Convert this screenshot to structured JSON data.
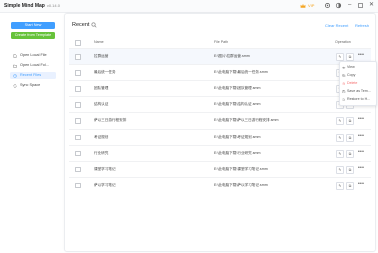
{
  "app": {
    "title": "Simple Mind Map",
    "version": "v0.14.0",
    "vip_label": "VIP"
  },
  "sidebar": {
    "start_label": "Start New",
    "template_label": "Create from Template",
    "items": [
      {
        "label": "Open Local File",
        "icon": "file-icon"
      },
      {
        "label": "Open Local Fol...",
        "icon": "folder-icon"
      },
      {
        "label": "Recent Files",
        "icon": "clock-icon",
        "active": true
      },
      {
        "label": "Sync Space",
        "icon": "sync-icon"
      }
    ]
  },
  "main": {
    "title": "Recent",
    "clear_label": "Clear Recent",
    "refresh_label": "Refresh",
    "columns": {
      "name": "Name",
      "path": "File Path",
      "operation": "Operation"
    },
    "rows": [
      {
        "name": "拉群运营",
        "path": "E:\\图片\\拉群运营.smm"
      },
      {
        "name": "最后统一任务",
        "path": "E:\\此电脑下载\\最后统一任务.smm"
      },
      {
        "name": "团队管理",
        "path": "E:\\此电脑下载\\团队管理.smm"
      },
      {
        "name": "结构认证",
        "path": "E:\\此电脑下载\\结构认证.smm"
      },
      {
        "name": "萨以三日游行程安排",
        "path": "E:\\此电脑下载\\萨以三日游行程安排.smm"
      },
      {
        "name": "考证规划",
        "path": "E:\\此电脑下载\\考证规划.smm"
      },
      {
        "name": "行业研究",
        "path": "E:\\此电脑下载\\行业研究.smm"
      },
      {
        "name": "课堂学习笔记",
        "path": "E:\\此电脑下载\\课堂学习笔记.smm"
      },
      {
        "name": "萨以学习笔记",
        "path": "E:\\此电脑下载\\萨以学习笔记.smm"
      }
    ],
    "op_edit_glyph": "✎",
    "op_open_glyph": "⧉",
    "more_glyph": "•••"
  },
  "dropdown": {
    "items": [
      {
        "label": "View",
        "icon": "eye-icon"
      },
      {
        "label": "Copy",
        "icon": "copy-icon"
      },
      {
        "label": "Delete",
        "icon": "trash-icon",
        "danger": true
      },
      {
        "label": "Save as Tem...",
        "icon": "save-icon"
      },
      {
        "label": "Restore to H...",
        "icon": "restore-icon"
      }
    ]
  },
  "colors": {
    "accent": "#409eff",
    "success": "#67c23a",
    "danger": "#f56c6c",
    "vip": "#f5a623"
  }
}
